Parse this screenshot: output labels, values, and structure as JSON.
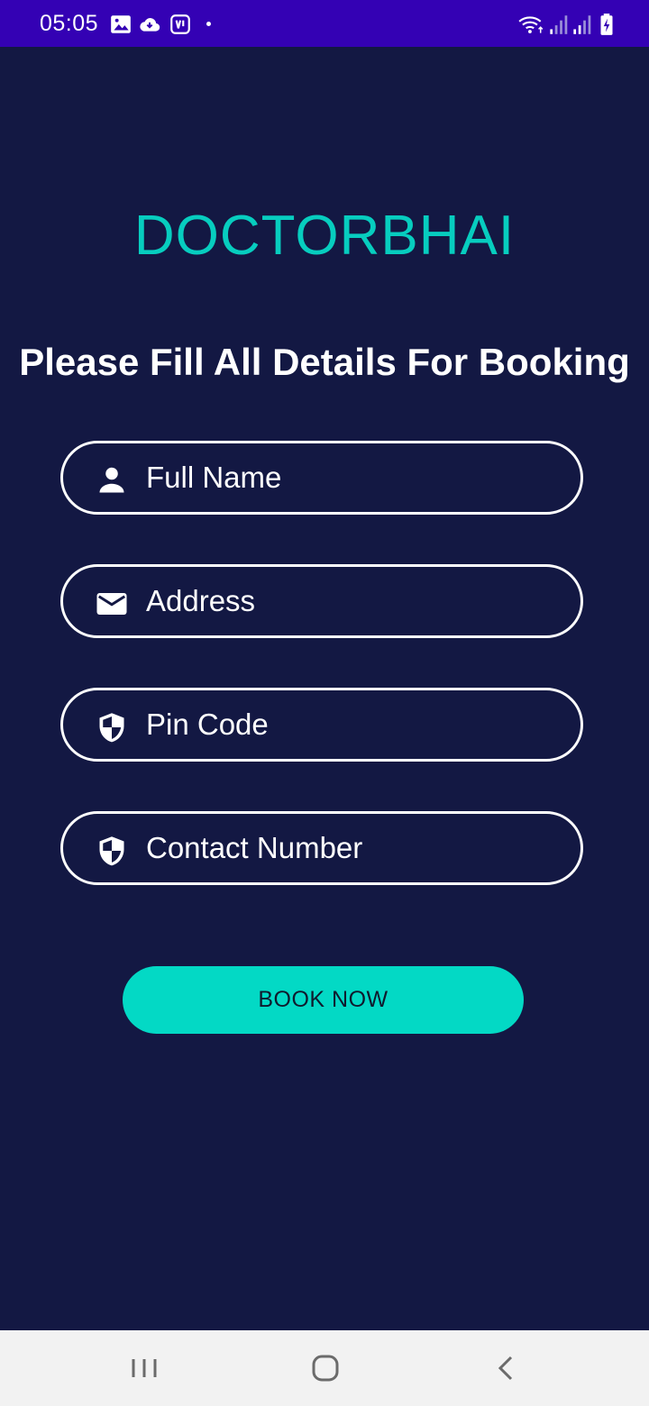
{
  "status_bar": {
    "time": "05:05",
    "icons": [
      "image-icon",
      "cloud-download-icon",
      "app-notification-icon",
      "wifi-icon",
      "signal-icon",
      "signal-icon",
      "battery-charging-icon"
    ]
  },
  "app": {
    "brand": "DOCTORBHAI",
    "subtitle": "Please Fill All Details For Booking"
  },
  "form": {
    "fields": [
      {
        "placeholder": "Full Name",
        "icon": "person-icon"
      },
      {
        "placeholder": "Address",
        "icon": "mail-icon"
      },
      {
        "placeholder": "Pin Code",
        "icon": "shield-icon"
      },
      {
        "placeholder": "Contact Number",
        "icon": "shield-icon"
      }
    ],
    "submit_label": "BOOK NOW"
  },
  "nav_bar": {
    "buttons": [
      "recent-apps-icon",
      "home-icon",
      "back-icon"
    ]
  },
  "colors": {
    "background": "#131843",
    "status_bar": "#3401b4",
    "accent": "#07cdbf",
    "button": "#03d9c5"
  }
}
